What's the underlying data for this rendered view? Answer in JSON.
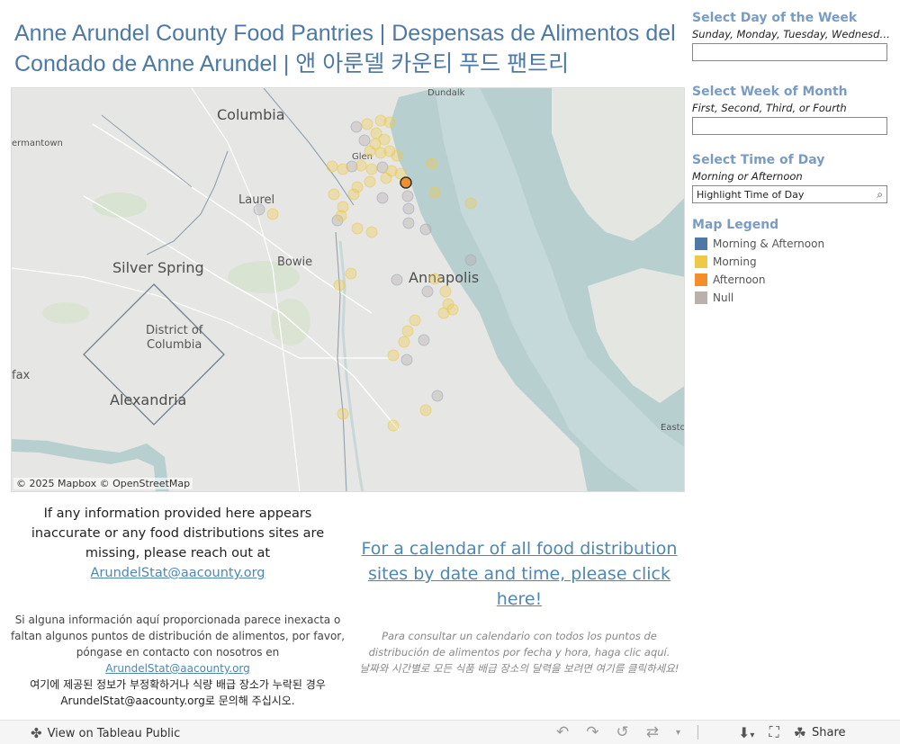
{
  "title": "Anne Arundel County Food Pantries | Despensas de Alimentos del Condado de Anne Arundel | 앤 아룬델 카운티 푸드 팬트리",
  "map": {
    "places": {
      "dundalk": "Dundalk",
      "columbia": "Columbia",
      "germantown": "ermantown",
      "glen": "Glen",
      "laurel": "Laurel",
      "silver_spring": "Silver Spring",
      "bowie": "Bowie",
      "annapolis": "Annapolis",
      "district": "District of",
      "columbia_dc": "Columbia",
      "fax": "fax",
      "alexandria": "Alexandria",
      "easton": "Easto"
    },
    "credit": "© 2025 Mapbox  © OpenStreetMap"
  },
  "filters": {
    "day": {
      "title": "Select Day of the Week",
      "subtitle": "Sunday, Monday, Tuesday, Wednesda...",
      "value": ""
    },
    "week": {
      "title": "Select Week of Month",
      "subtitle": "First, Second, Third, or Fourth",
      "value": ""
    },
    "time": {
      "title": "Select Time of Day",
      "subtitle": "Morning or Afternoon",
      "value": "Highlight Time of Day"
    }
  },
  "legend": {
    "title": "Map Legend",
    "items": [
      {
        "label": "Morning & Afternoon",
        "color": "#4e79a7"
      },
      {
        "label": "Morning",
        "color": "#edc948"
      },
      {
        "label": "Afternoon",
        "color": "#f28e2b"
      },
      {
        "label": "Null",
        "color": "#bab0ac"
      }
    ]
  },
  "info": {
    "en_text": "If any information provided here appears inaccurate or any food distributions sites are missing, please reach out at",
    "en_email": "ArundelStat@aacounty.org",
    "es_text": "Si alguna información aquí proporcionada parece inexacta o faltan algunos puntos de distribución de alimentos, por favor, póngase en contacto con nosotros en",
    "es_email": "ArundelStat@aacounty.org",
    "ko_text": "여기에 제공된 정보가 부정확하거나 식량 배급 장소가 누락된 경우 ArundelStat@aacounty.org로 문의해 주십시오."
  },
  "calendar": {
    "link_text": "For a calendar of all food distribution sites by date and time, please click here!",
    "es_text": "Para consultar un calendario con todos los puntos de distribución de alimentos por fecha y hora, haga clic aquí.",
    "ko_text": "날짜와 시간별로 모든 식품 배급 장소의 달력을 보려면 여기를 클릭하세요!"
  },
  "bottom_bar": {
    "view_label": "View on Tableau Public",
    "share_label": "Share"
  }
}
